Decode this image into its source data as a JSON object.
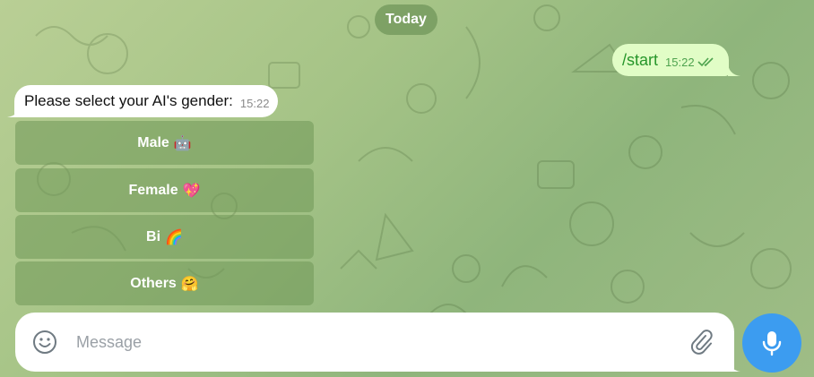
{
  "chat": {
    "date_divider": "Today",
    "outgoing": {
      "text": "/start",
      "time": "15:22",
      "status_icon": "double-check-icon"
    },
    "incoming": {
      "text": "Please select your AI's gender:",
      "time": "15:22"
    },
    "keyboard": [
      {
        "label": "Male",
        "emoji": "🤖"
      },
      {
        "label": "Female",
        "emoji": "💖"
      },
      {
        "label": "Bi",
        "emoji": "🌈"
      },
      {
        "label": "Others",
        "emoji": "🤗"
      }
    ]
  },
  "composer": {
    "placeholder": "Message",
    "emoji_icon": "smile-icon",
    "attach_icon": "paperclip-icon",
    "send_icon": "microphone-icon"
  },
  "colors": {
    "background": "#a6c487",
    "outgoing_bubble": "#e1fdc6",
    "outgoing_text": "#26962a",
    "incoming_bubble": "#ffffff",
    "keyboard_button": "#7d9d5e",
    "mic_button": "#3c9cf0"
  }
}
